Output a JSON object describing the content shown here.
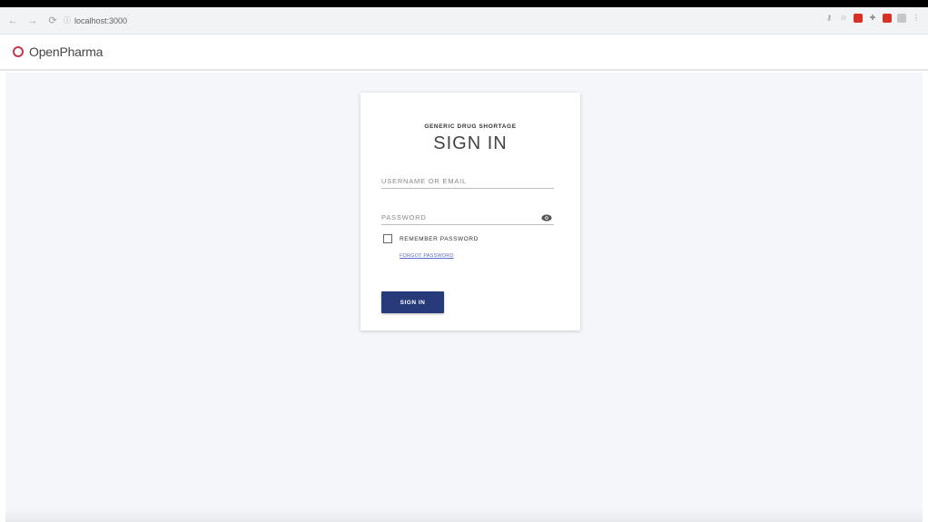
{
  "browser": {
    "url": "localhost:3000",
    "nav": {
      "back": "←",
      "forward": "→",
      "reload": "⟳",
      "info": "ⓘ"
    },
    "extensions": [
      "key-icon",
      "star-icon",
      "extension-red-icon",
      "puzzle-icon",
      "extension-red2-icon",
      "profile-icon",
      "menu-icon"
    ]
  },
  "app": {
    "name": "OpenPharma",
    "brand_color": "#c0364d"
  },
  "login": {
    "subtitle": "GENERIC DRUG SHORTAGE",
    "title": "SIGN IN",
    "username_placeholder": "USERNAME OR EMAIL",
    "password_placeholder": "PASSWORD",
    "remember_label": "REMEMBER PASSWORD",
    "remember_checked": false,
    "forgot_label": "FORGOT PASSWORD",
    "submit_label": "SIGN IN",
    "submit_color": "#273a7a"
  }
}
